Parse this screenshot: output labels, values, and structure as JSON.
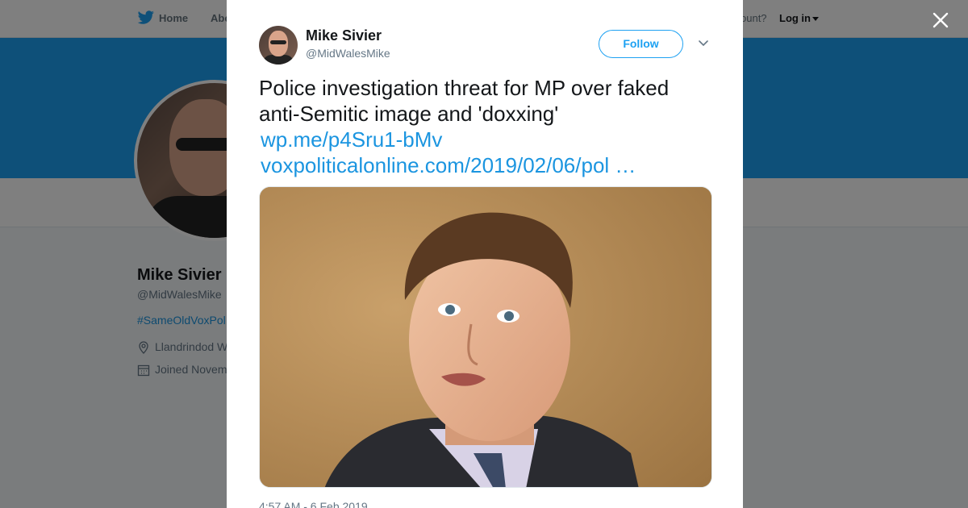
{
  "nav": {
    "home": "Home",
    "about": "Abo",
    "account_prompt": "ccount?",
    "login": "Log in"
  },
  "profile": {
    "name": "Mike Sivier",
    "handle": "@MidWalesMike",
    "hashtag": "#SameOldVoxPol",
    "location": "Llandrindod W",
    "joined": "Joined Novem"
  },
  "tweet": {
    "author_name": "Mike Sivier",
    "author_handle": "@MidWalesMike",
    "follow_label": "Follow",
    "text": "Police investigation threat for MP over faked anti-Semitic image and 'doxxing'",
    "link1": "wp.me/p4Sru1-bMv",
    "link2": "voxpoliticalonline.com/2019/02/06/pol  …",
    "timestamp": "4:57 AM - 6 Feb 2019"
  },
  "colors": {
    "accent": "#1da1f2",
    "link": "#1b95e0",
    "text": "#14171a",
    "muted": "#657786"
  },
  "icons": [
    "twitter-bird-icon",
    "close-icon",
    "chevron-down-icon",
    "location-icon",
    "calendar-icon"
  ]
}
